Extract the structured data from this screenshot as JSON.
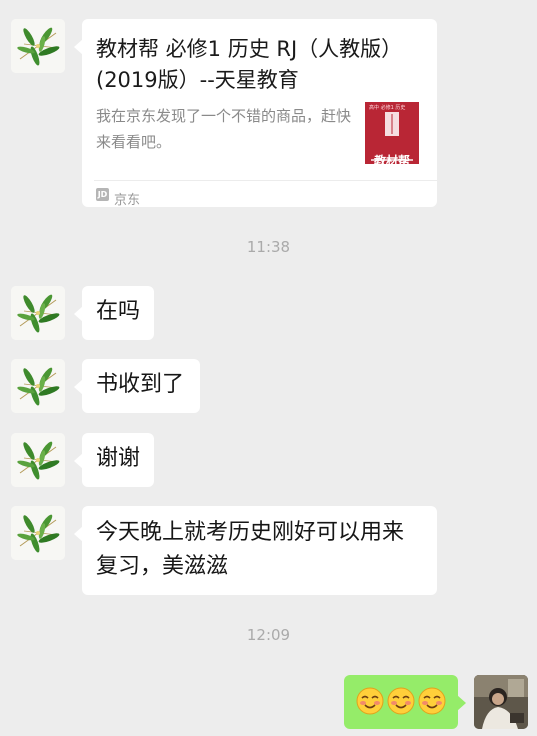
{
  "card": {
    "title": "教材帮 必修1 历史 RJ（人教版）(2019版）--天星教育",
    "description": "我在京东发现了一个不错的商品，赶快来看看吧。",
    "thumb_label": "教材帮",
    "thumb_mini": "高中 必修1 历史",
    "source_icon": "JD",
    "source": "京东"
  },
  "timestamps": [
    "11:38",
    "12:09"
  ],
  "messages": [
    {
      "text": "在吗"
    },
    {
      "text": "书收到了"
    },
    {
      "text": "谢谢"
    },
    {
      "line1": "今天晚上就考历史刚好可以用来",
      "line2": "复习，美滋滋"
    }
  ],
  "sent": {
    "emoji": [
      "blush-emoji",
      "blush-emoji",
      "blush-emoji"
    ]
  },
  "colors": {
    "background": "#ededed",
    "received_bubble": "#ffffff",
    "sent_bubble": "#95ec69",
    "thumb": "#b92635"
  }
}
